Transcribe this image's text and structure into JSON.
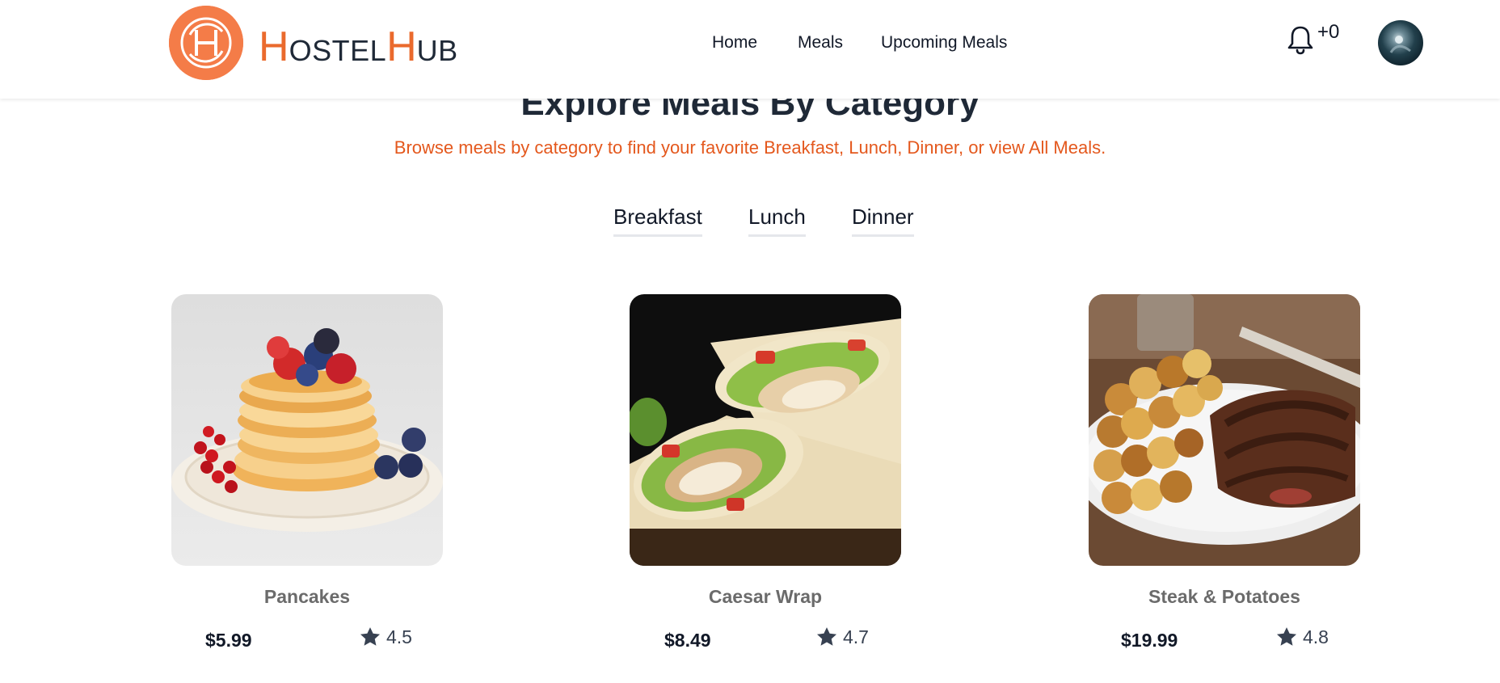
{
  "brand": {
    "name_cap1": "H",
    "name_rest1": "OSTEL",
    "name_cap2": "H",
    "name_rest2": "UB",
    "logo_icon": "hostelhub-logo-icon",
    "accent_color": "#f47c48"
  },
  "nav": {
    "items": [
      {
        "label": "Home"
      },
      {
        "label": "Meals"
      },
      {
        "label": "Upcoming Meals"
      }
    ]
  },
  "notifications": {
    "icon": "bell-icon",
    "count_text": "+0"
  },
  "user": {
    "avatar_icon": "user-avatar"
  },
  "category_section": {
    "title": "Explore Meals By Category",
    "subtitle": "Browse meals by category to find your favorite Breakfast, Lunch, Dinner, or view All Meals.",
    "tabs": [
      {
        "label": "Breakfast"
      },
      {
        "label": "Lunch"
      },
      {
        "label": "Dinner"
      }
    ]
  },
  "meals": [
    {
      "name": "Pancakes",
      "price": "$5.99",
      "rating": "4.5",
      "image": "pancakes-photo"
    },
    {
      "name": "Caesar Wrap",
      "price": "$8.49",
      "rating": "4.7",
      "image": "caesar-wrap-photo"
    },
    {
      "name": "Steak & Potatoes",
      "price": "$19.99",
      "rating": "4.8",
      "image": "steak-potatoes-photo"
    }
  ],
  "colors": {
    "subtitle": "#e4581d",
    "brand_orange": "#ea6a2d",
    "star": "#374151"
  }
}
